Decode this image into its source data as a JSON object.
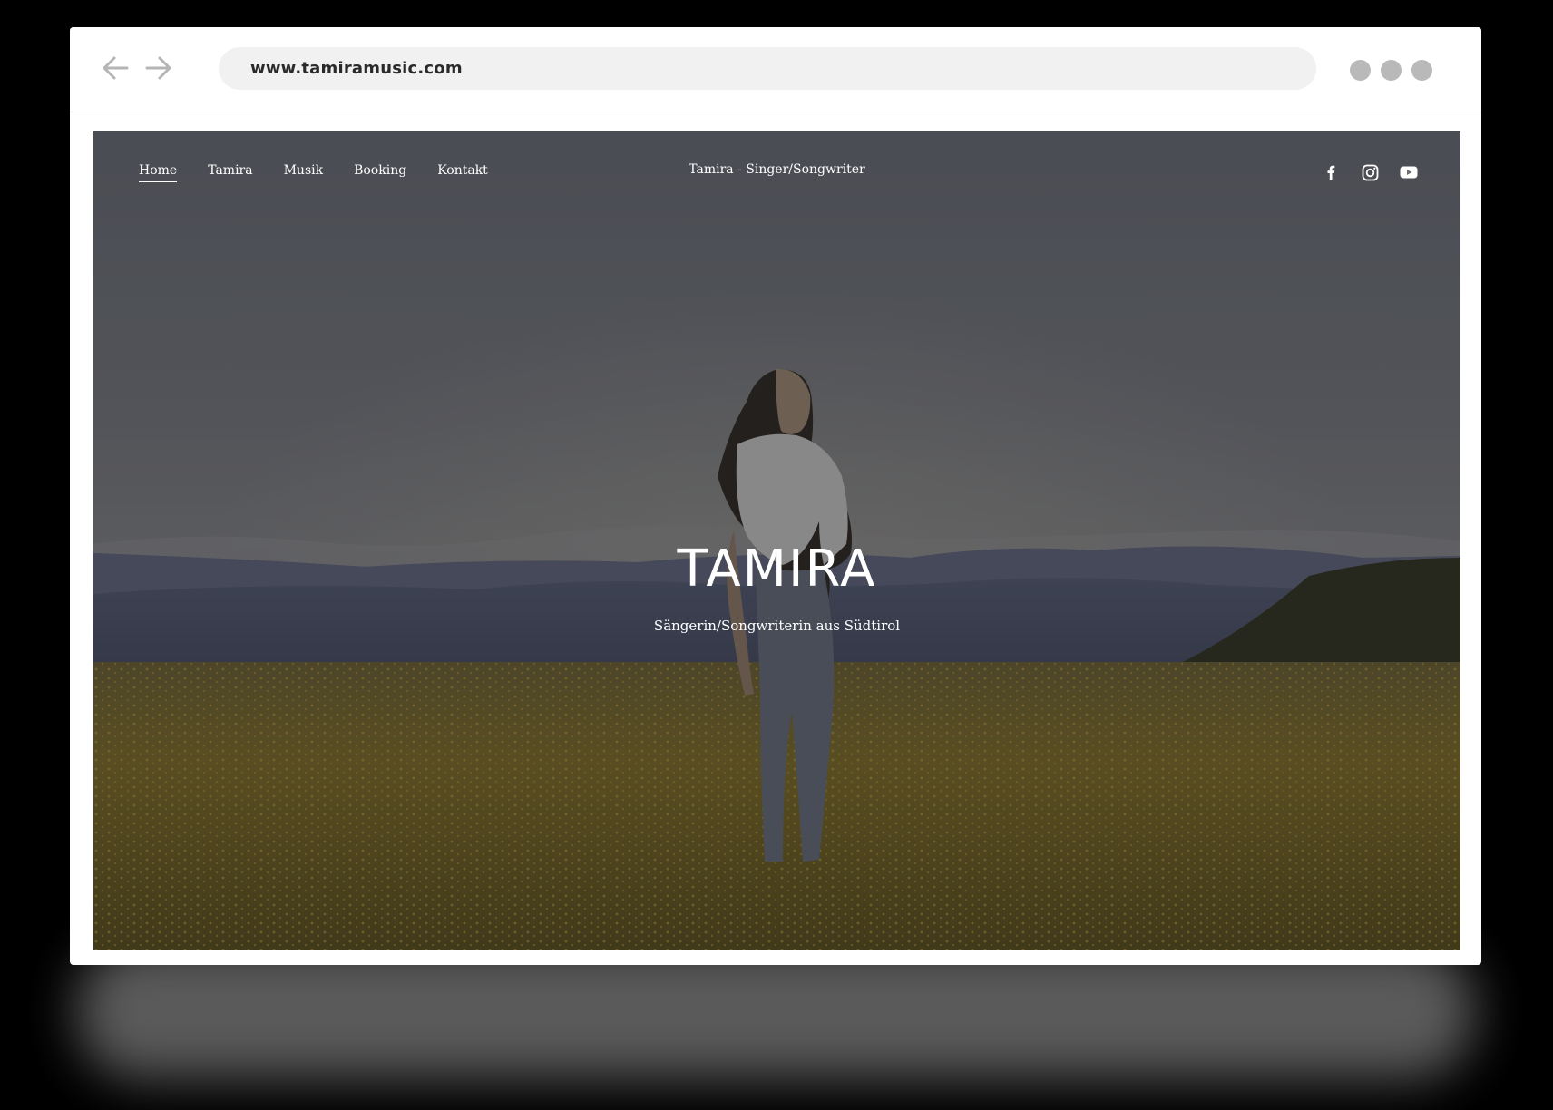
{
  "browser": {
    "url": "www.tamiramusic.com",
    "back_icon": "arrow-left-icon",
    "forward_icon": "arrow-right-icon",
    "window_dots_color": "#b9b9b9"
  },
  "site": {
    "nav": [
      {
        "label": "Home",
        "active": true
      },
      {
        "label": "Tamira",
        "active": false
      },
      {
        "label": "Musik",
        "active": false
      },
      {
        "label": "Booking",
        "active": false
      },
      {
        "label": "Kontakt",
        "active": false
      }
    ],
    "site_title": "Tamira - Singer/Songwriter",
    "social_icons": [
      "facebook-icon",
      "instagram-icon",
      "youtube-icon"
    ],
    "hero": {
      "heading": "TAMIRA",
      "subheading": "Sängerin/Songwriterin aus Südtirol"
    }
  },
  "colors": {
    "page_background": "#000000",
    "browser_frame": "#ffffff",
    "address_bar": "#f1f1f1",
    "hero_text": "#ffffff",
    "field_gold": "#7a6a2c",
    "sky_grey": "#6b6e76"
  }
}
